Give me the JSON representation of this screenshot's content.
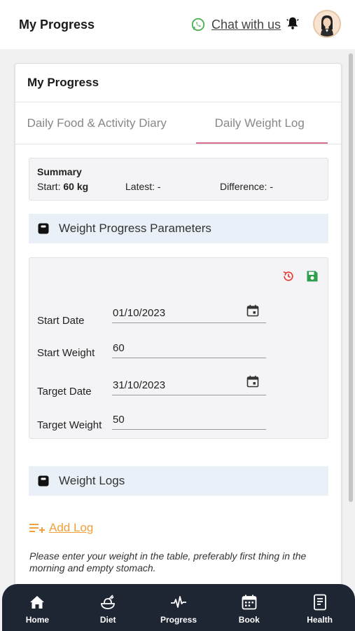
{
  "header": {
    "title": "My Progress",
    "chat_label": "Chat with us"
  },
  "card": {
    "title": "My Progress",
    "tabs": [
      {
        "label": "Daily Food & Activity Diary",
        "active": false
      },
      {
        "label": "Daily Weight Log",
        "active": true
      }
    ]
  },
  "summary": {
    "title": "Summary",
    "start_label": "Start:",
    "start_value": "60 kg",
    "latest_label": "Latest:",
    "latest_value": "-",
    "difference_label": "Difference:",
    "difference_value": "-"
  },
  "params_section": {
    "title": "Weight Progress Parameters",
    "fields": [
      {
        "label": "Start Date",
        "value": "01/10/2023",
        "type": "date"
      },
      {
        "label": "Start Weight",
        "value": "60",
        "type": "number"
      },
      {
        "label": "Target Date",
        "value": "31/10/2023",
        "type": "date"
      },
      {
        "label": "Target Weight",
        "value": "50",
        "type": "number"
      }
    ]
  },
  "logs_section": {
    "title": "Weight Logs",
    "add_label": "Add Log",
    "note": "Please enter your weight in the table, preferably first thing in the morning and empty stomach."
  },
  "bottom_nav": [
    {
      "label": "Home",
      "icon": "home-icon"
    },
    {
      "label": "Diet",
      "icon": "diet-icon"
    },
    {
      "label": "Progress",
      "icon": "progress-icon"
    },
    {
      "label": "Book",
      "icon": "calendar-icon"
    },
    {
      "label": "Health",
      "icon": "health-icon"
    }
  ],
  "colors": {
    "accent_tab": "#d86f8d",
    "add_log": "#f0a03c",
    "whatsapp": "#4caf50",
    "reset": "#e53935",
    "save": "#2e9e4f",
    "nav_bg": "#1e2533",
    "section_bg": "#eaf0f7"
  }
}
